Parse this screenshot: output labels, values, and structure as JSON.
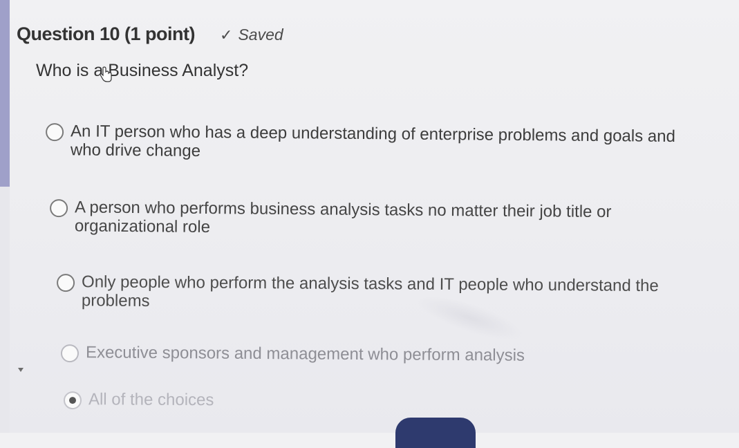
{
  "question": {
    "title": "Question 10 (1 point)",
    "saved_label": "Saved",
    "prompt": "Who is a Business Analyst?"
  },
  "options": [
    {
      "label": "An IT person who has a deep understanding of enterprise problems and goals and who drive change",
      "selected": false
    },
    {
      "label": "A person who performs business analysis tasks no matter their job title or organizational role",
      "selected": false
    },
    {
      "label": "Only people who perform the analysis tasks and IT people who understand the problems",
      "selected": false
    },
    {
      "label": "Executive sponsors and management who perform analysis",
      "selected": false
    },
    {
      "label": "All of the choices",
      "selected": true
    }
  ],
  "icons": {
    "saved": "check-icon",
    "cursor": "hand-cursor-icon"
  },
  "colors": {
    "accent_bar": "#9fa0c9",
    "button": "#2e3a6e"
  }
}
